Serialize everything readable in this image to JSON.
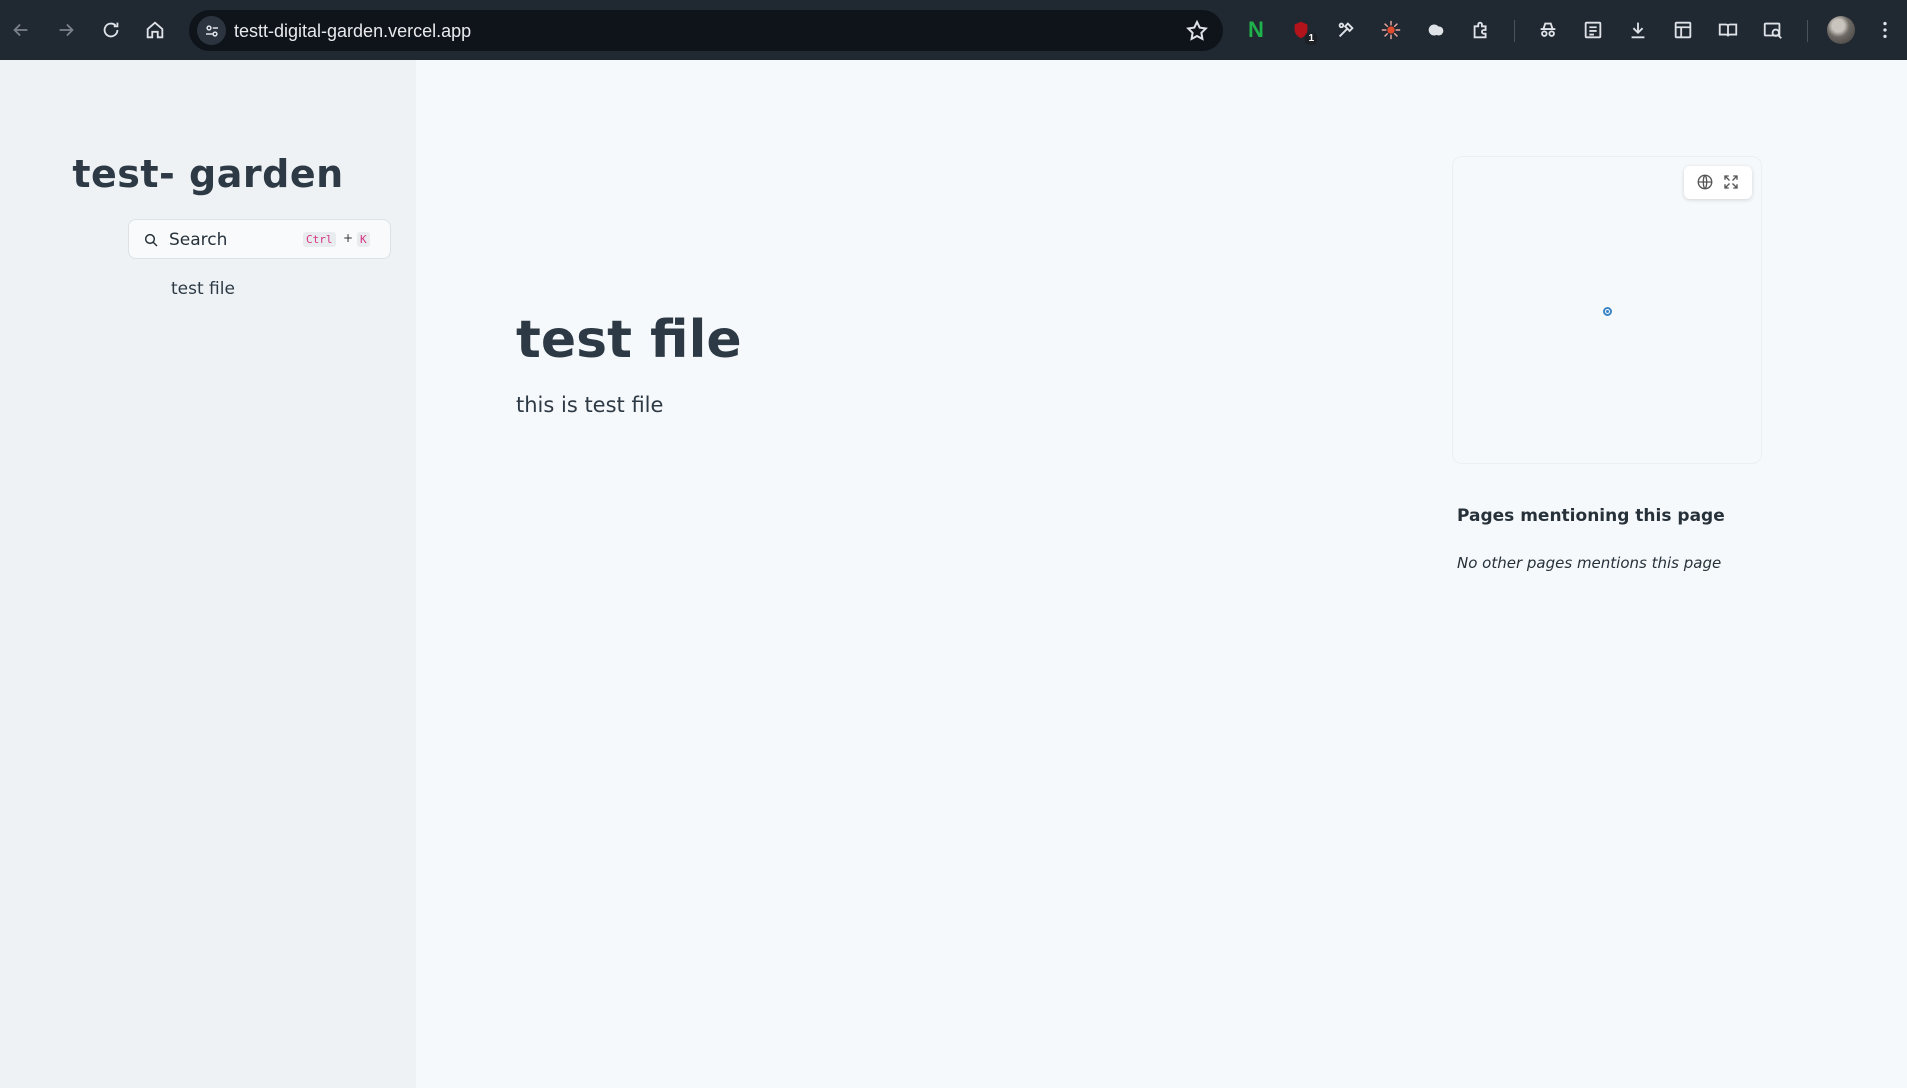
{
  "browser": {
    "url": "testt-digital-garden.vercel.app",
    "extensions_badge_count": "1",
    "extension_n_letter": "N",
    "colors": {
      "chrome_bg": "#202832",
      "omnibox_bg": "#0f141a"
    }
  },
  "sidebar": {
    "site_title": "test- garden",
    "search": {
      "label": "Search",
      "shortcut_key1": "Ctrl",
      "shortcut_plus": "+",
      "shortcut_key2": "K"
    },
    "items": [
      {
        "label": "test file"
      }
    ]
  },
  "main": {
    "title": "test file",
    "body": "this is test file"
  },
  "right_panel": {
    "graph": {
      "node_color": "#3b86c6"
    },
    "mentions_title": "Pages mentioning this page",
    "mentions_empty": "No other pages mentions this page"
  }
}
